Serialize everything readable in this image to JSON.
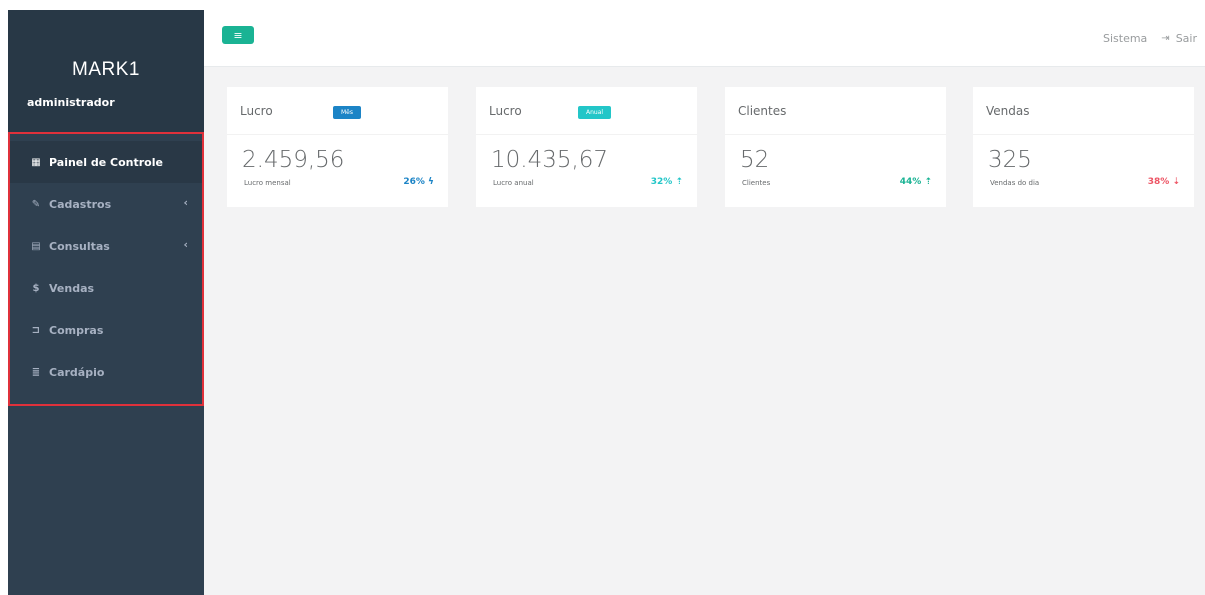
{
  "sidebar": {
    "brand": "MARK1",
    "user_role": "administrador",
    "items": [
      {
        "label": "Painel de Controle",
        "icon": "th-large-icon",
        "glyph": "▦",
        "active": true
      },
      {
        "label": "Cadastros",
        "icon": "edit-icon",
        "glyph": "✎",
        "has_submenu": true
      },
      {
        "label": "Consultas",
        "icon": "table-icon",
        "glyph": "▤",
        "has_submenu": true
      },
      {
        "label": "Vendas",
        "icon": "dollar-icon",
        "glyph": "$"
      },
      {
        "label": "Compras",
        "icon": "cart-icon",
        "glyph": "⊐"
      },
      {
        "label": "Cardápio",
        "icon": "list-icon",
        "glyph": "≣"
      }
    ],
    "submenu_chevron": "‹"
  },
  "topbar": {
    "menu_toggle_glyph": "≡",
    "system_link": "Sistema",
    "logout_glyph": "⇥",
    "logout_label": "Sair"
  },
  "cards": [
    {
      "title": "Lucro",
      "badge": "Mês",
      "badge_color": "#1c84c6",
      "value": "2.459,56",
      "label": "Lucro mensal",
      "pct": "26% ϟ",
      "pct_color": "#1c84c6"
    },
    {
      "title": "Lucro",
      "badge": "Anual",
      "badge_color": "#23c6c8",
      "value": "10.435,67",
      "label": "Lucro anual",
      "pct": "32% ⇡",
      "pct_color": "#23c6c8"
    },
    {
      "title": "Clientes",
      "badge": "",
      "value": "52",
      "label": "Clientes",
      "pct": "44% ⇡",
      "pct_color": "#1ab394"
    },
    {
      "title": "Vendas",
      "badge": "",
      "value": "325",
      "label": "Vendas do dia",
      "pct": "38% ⇣",
      "pct_color": "#ed5565"
    }
  ],
  "colors": {
    "sidebar_bg": "#2f4050",
    "accent_green": "#1ab394",
    "highlight_border": "#e0313b",
    "content_bg": "#f3f3f4"
  }
}
